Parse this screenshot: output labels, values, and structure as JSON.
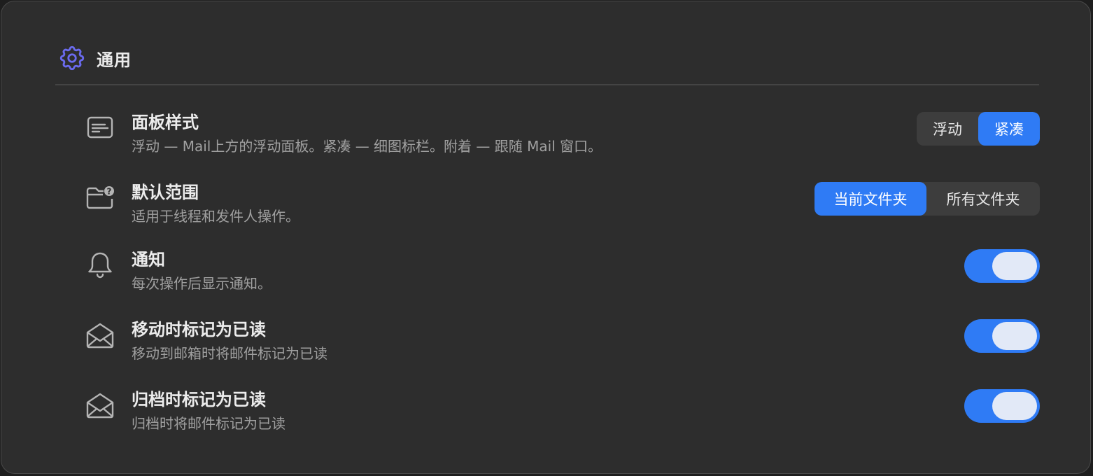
{
  "section": {
    "title": "通用",
    "icon": "gear-icon",
    "accent": "#6b6bef"
  },
  "colors": {
    "accent_blue": "#2f7bf5",
    "panel_bg": "#2d2d2d",
    "segment_bg": "#3d3d3d"
  },
  "panel_style": {
    "title": "面板样式",
    "description": "浮动 — Mail上方的浮动面板。紧凑 — 细图标栏。附着 — 跟随 Mail 窗口。",
    "icon": "panel-icon",
    "options": [
      "浮动",
      "紧凑"
    ],
    "selected": "紧凑"
  },
  "default_scope": {
    "title": "默认范围",
    "description": "适用于线程和发件人操作。",
    "icon": "folder-question-icon",
    "options": [
      "当前文件夹",
      "所有文件夹"
    ],
    "selected": "当前文件夹"
  },
  "notifications": {
    "title": "通知",
    "description": "每次操作后显示通知。",
    "icon": "bell-icon",
    "enabled": true
  },
  "mark_read_on_move": {
    "title": "移动时标记为已读",
    "description": "移动到邮箱时将邮件标记为已读",
    "icon": "envelope-open-icon",
    "enabled": true
  },
  "mark_read_on_archive": {
    "title": "归档时标记为已读",
    "description": "归档时将邮件标记为已读",
    "icon": "envelope-open-icon",
    "enabled": true
  }
}
